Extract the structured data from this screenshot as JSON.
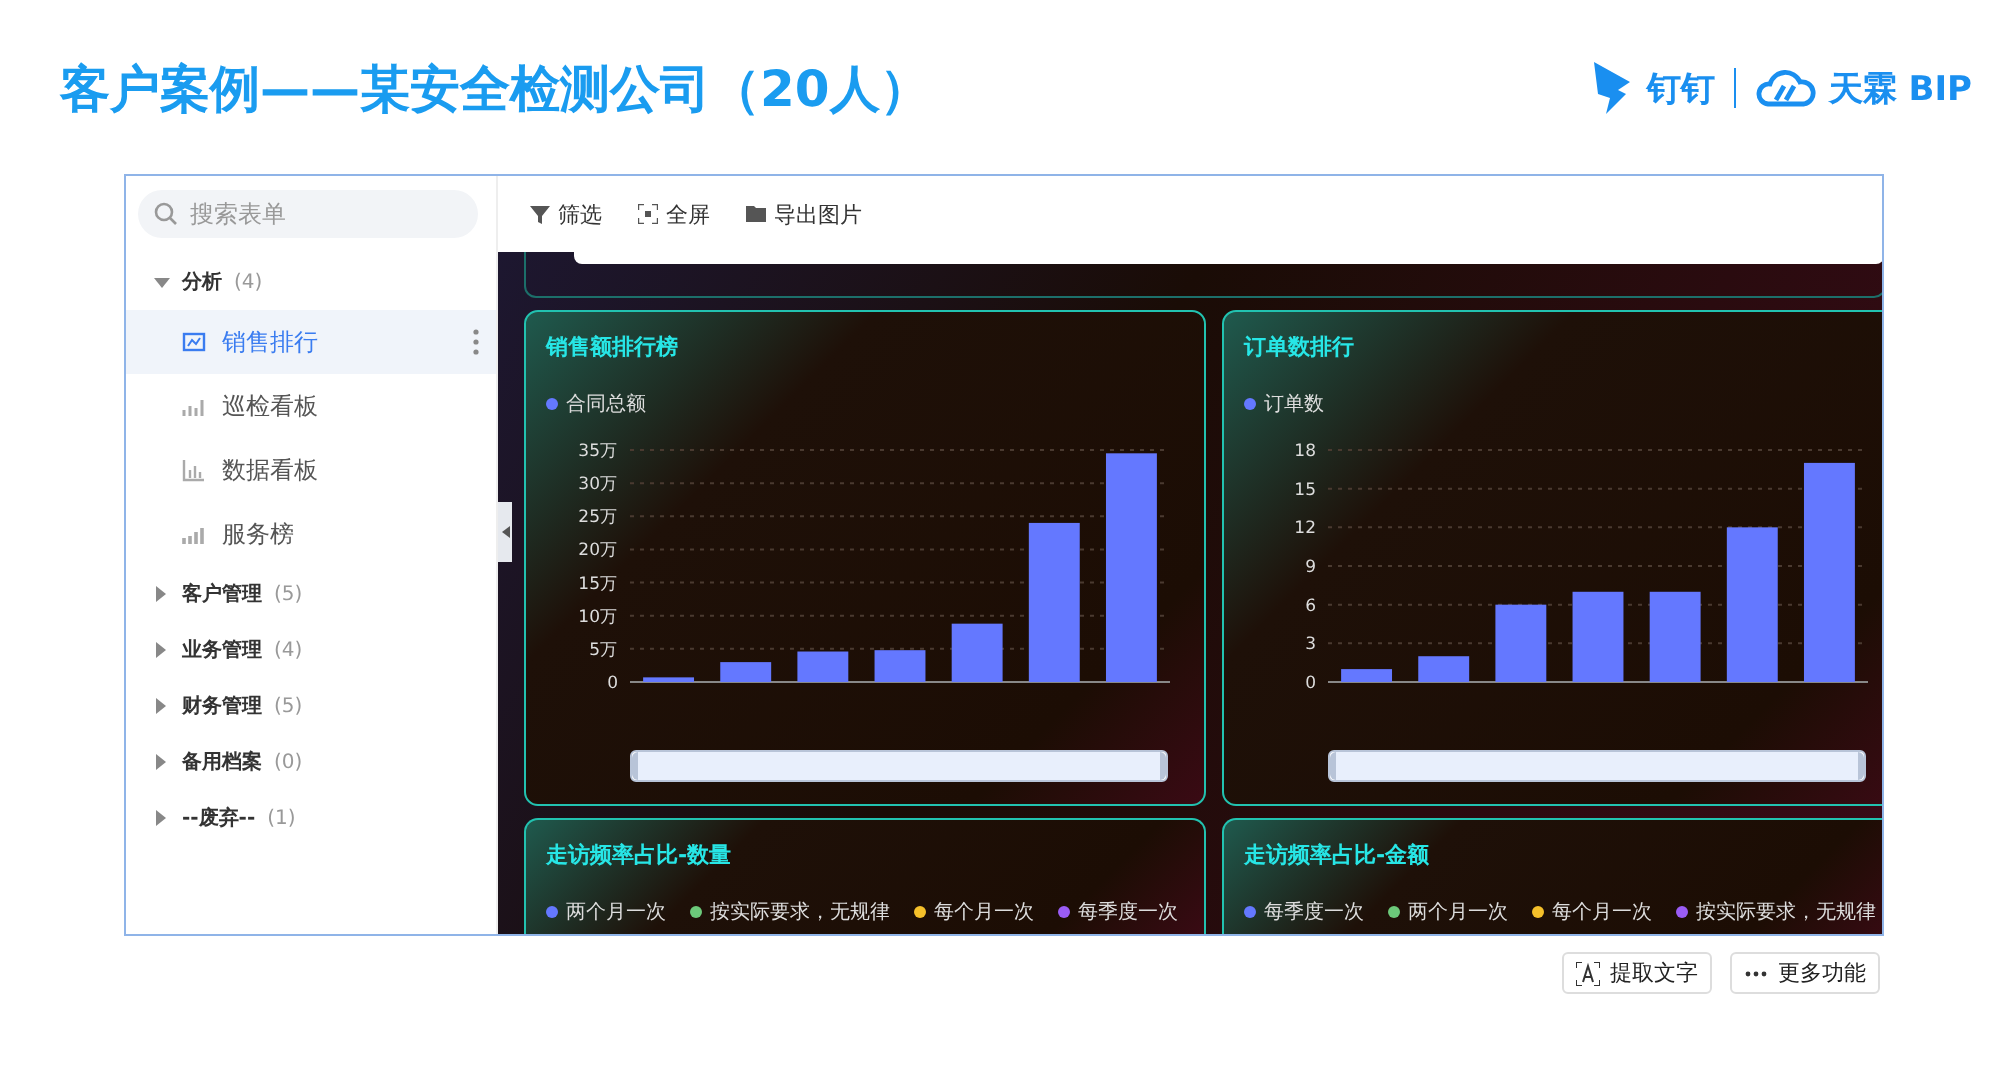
{
  "slide": {
    "title": "客户案例——某安全检测公司（20人）",
    "brands": [
      "钉钉",
      "天霖 BIP"
    ]
  },
  "sidebar": {
    "search": {
      "placeholder": "搜索表单"
    },
    "groups": [
      {
        "name": "分析",
        "count": "(4)",
        "expanded": true,
        "children": [
          {
            "name": "销售排行",
            "selected": true
          },
          {
            "name": "巡检看板",
            "selected": false
          },
          {
            "name": "数据看板",
            "selected": false
          },
          {
            "name": "服务榜",
            "selected": false
          }
        ]
      },
      {
        "name": "客户管理",
        "count": "(5)",
        "expanded": false
      },
      {
        "name": "业务管理",
        "count": "(4)",
        "expanded": false
      },
      {
        "name": "财务管理",
        "count": "(5)",
        "expanded": false
      },
      {
        "name": "备用档案",
        "count": "(0)",
        "expanded": false
      },
      {
        "name": "--废弃--",
        "count": "(1)",
        "expanded": false
      }
    ]
  },
  "toolbar": [
    "筛选",
    "全屏",
    "导出图片"
  ],
  "charts": [
    {
      "title": "销售额排行榜",
      "zoom_slider": {
        "level": 1
      },
      "chart_data": {
        "type": "bar",
        "series": [
          {
            "name": "合同总额",
            "color": "#6478ff",
            "values": [
              0.7,
              3,
              4.6,
              4.8,
              8.8,
              24,
              34.5
            ]
          }
        ],
        "ylim": [
          0,
          35
        ],
        "grid": true,
        "yticks": [
          {
            "value": 0,
            "label": "0"
          },
          {
            "value": 5,
            "label": "5万"
          },
          {
            "value": 10,
            "label": "10万"
          },
          {
            "value": 15,
            "label": "15万"
          },
          {
            "value": 20,
            "label": "20万"
          },
          {
            "value": 25,
            "label": "25万"
          },
          {
            "value": 30,
            "label": "30万"
          },
          {
            "value": 35,
            "label": "35万"
          }
        ]
      }
    },
    {
      "title": "订单数排行",
      "zoom_slider": {
        "level": 1
      },
      "chart_data": {
        "type": "bar",
        "series": [
          {
            "name": "订单数",
            "color": "#6478ff",
            "values": [
              1,
              2,
              6,
              7,
              7,
              12,
              17
            ]
          }
        ],
        "ylim": [
          0,
          18
        ],
        "grid": true,
        "yticks": [
          0,
          3,
          6,
          9,
          12,
          15,
          18
        ]
      }
    }
  ],
  "pies": [
    {
      "title": "走访频率占比-数量",
      "legend": [
        {
          "name": "两个月一次",
          "color": "#6478ff"
        },
        {
          "name": "按实际要求，无规律",
          "color": "#6cc97a"
        },
        {
          "name": "每个月一次",
          "color": "#f5c02a"
        },
        {
          "name": "每季度一次",
          "color": "#9a5cf5"
        }
      ]
    },
    {
      "title": "走访频率占比-金额",
      "legend": [
        {
          "name": "每季度一次",
          "color": "#6478ff"
        },
        {
          "name": "两个月一次",
          "color": "#6cc97a"
        },
        {
          "name": "每个月一次",
          "color": "#f5c02a"
        },
        {
          "name": "按实际要求，无规律",
          "color": "#9a5cf5"
        }
      ]
    }
  ],
  "viewer_buttons": [
    "提取文字",
    "更多功能"
  ]
}
